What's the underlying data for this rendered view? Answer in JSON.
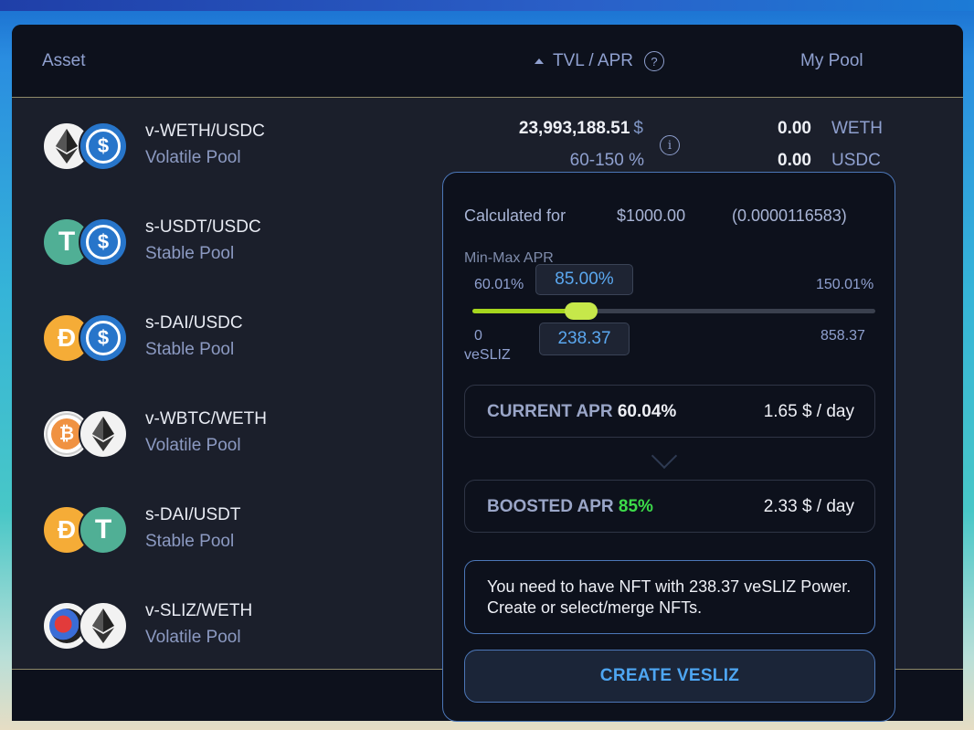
{
  "header": {
    "asset": "Asset",
    "tvl_apr": "TVL / APR",
    "help": "?",
    "my_pool": "My Pool"
  },
  "rows": [
    {
      "pair": "v-WETH/USDC",
      "type": "Volatile Pool",
      "tvl": "23,993,188.51",
      "tvl_unit": "$",
      "apr": "60-150 %",
      "info": "i",
      "my_pool": [
        {
          "value": "0.00",
          "unit": "WETH"
        },
        {
          "value": "0.00",
          "unit": "USDC"
        }
      ],
      "icons": [
        "eth-icon",
        "usdc-icon"
      ]
    },
    {
      "pair": "s-USDT/USDC",
      "type": "Stable Pool",
      "icons": [
        "usdt-icon",
        "usdc-icon"
      ]
    },
    {
      "pair": "s-DAI/USDC",
      "type": "Stable Pool",
      "icons": [
        "dai-icon",
        "usdc-icon"
      ]
    },
    {
      "pair": "v-WBTC/WETH",
      "type": "Volatile Pool",
      "icons": [
        "wbtc-icon",
        "eth-icon"
      ]
    },
    {
      "pair": "s-DAI/USDT",
      "type": "Stable Pool",
      "icons": [
        "dai-icon",
        "usdt-icon"
      ]
    },
    {
      "pair": "v-SLIZ/WETH",
      "type": "Volatile Pool",
      "icons": [
        "sliz-icon",
        "eth-icon"
      ]
    }
  ],
  "popup": {
    "calculated_for": "Calculated for",
    "amount": "$1000.00",
    "amount_tokens": "(0.0000116583)",
    "min_max_label": "Min-Max APR",
    "min_apr": "60.01%",
    "current_apr_value": "85.00%",
    "max_apr": "150.01%",
    "slider_fraction": 0.27,
    "vesliz_min": "0",
    "vesliz_label": "veSLIZ",
    "vesliz_value": "238.37",
    "vesliz_max": "858.37",
    "current": {
      "label": "CURRENT APR",
      "pct": "60.04%",
      "per_day": "1.65 $ / day"
    },
    "boosted": {
      "label": "BOOSTED APR",
      "pct": "85%",
      "per_day": "2.33 $ / day"
    },
    "message": "You need to have NFT with 238.37 veSLIZ Power. Create or select/merge NFTs.",
    "button": "CREATE VESLIZ"
  },
  "colors": {
    "accent": "#4ea6f2",
    "slider": "#a6d61e",
    "boosted": "#3ddc4a",
    "panel": "#1b1f2b"
  }
}
